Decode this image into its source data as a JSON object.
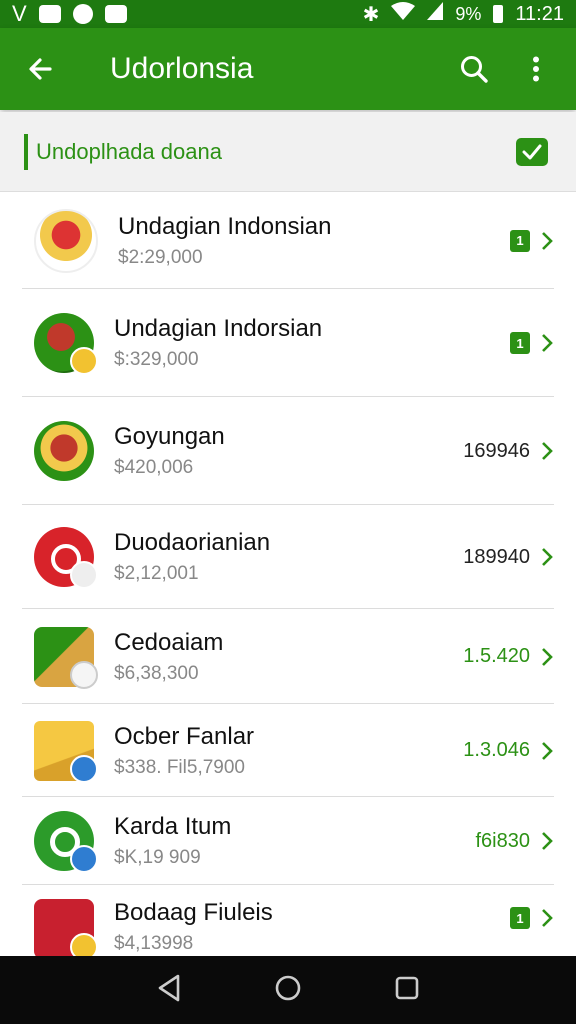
{
  "status": {
    "left_letter": "V",
    "battery": "9%",
    "time": "11:21"
  },
  "appbar": {
    "title": "Udorlonsia"
  },
  "subheader": {
    "label": "Undoplhada doana"
  },
  "items": [
    {
      "name": "Undagian Indonsian",
      "amount": "$2:29,000",
      "value": "",
      "badge": "1",
      "value_green": false
    },
    {
      "name": "Undagian Indorsian",
      "amount": "$:329,000",
      "value": "",
      "badge": "1",
      "value_green": false
    },
    {
      "name": "Goyungan",
      "amount": "$420,006",
      "value": "169946",
      "badge": "",
      "value_green": false
    },
    {
      "name": "Duodaorianian",
      "amount": "$2,12,001",
      "value": "189940",
      "badge": "",
      "value_green": false
    },
    {
      "name": "Cedoaiam",
      "amount": "$6,38,300",
      "value": "1.5.420",
      "badge": "",
      "value_green": true
    },
    {
      "name": "Ocber Fanlar",
      "amount": "$338. Fil5,7900",
      "value": "1.3.046",
      "badge": "",
      "value_green": true
    },
    {
      "name": "Karda Itum",
      "amount": "$K,19 909",
      "value": "f6i830",
      "badge": "",
      "value_green": true
    },
    {
      "name": "Bodaag Fiuleis",
      "amount": "$4,13998",
      "value": "",
      "badge": "1",
      "value_green": false
    }
  ],
  "colors": {
    "accent": "#2c9115",
    "statusbar": "#1e7a10",
    "navbar": "#0a0a0a"
  },
  "icons": [
    "back-arrow-icon",
    "search-icon",
    "more-vert-icon",
    "checkbox-checked-icon",
    "chevron-right-icon",
    "nav-back-icon",
    "nav-home-icon",
    "nav-recents-icon"
  ]
}
